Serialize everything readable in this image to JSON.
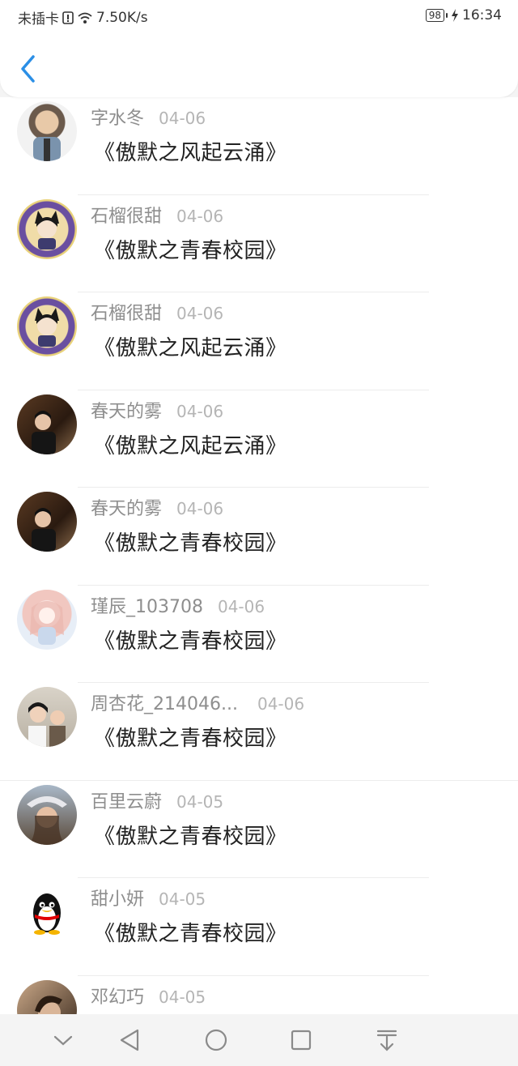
{
  "status_bar": {
    "carrier": "未插卡",
    "speed": "7.50K/s",
    "battery": "98",
    "time": "16:34"
  },
  "messages": [
    {
      "name": "字水冬",
      "date": "04-06",
      "title": "《傲默之风起云涌》",
      "avatar": "avatar-cartoon-boy-jacket"
    },
    {
      "name": "石榴很甜",
      "date": "04-06",
      "title": "《傲默之青春校园》",
      "avatar": "avatar-anime-catboy"
    },
    {
      "name": "石榴很甜",
      "date": "04-06",
      "title": "《傲默之风起云涌》",
      "avatar": "avatar-anime-catboy"
    },
    {
      "name": "春天的雾",
      "date": "04-06",
      "title": "《傲默之风起云涌》",
      "avatar": "avatar-photo-man"
    },
    {
      "name": "春天的雾",
      "date": "04-06",
      "title": "《傲默之青春校园》",
      "avatar": "avatar-photo-man"
    },
    {
      "name": "瑾辰_103708",
      "date": "04-06",
      "title": "《傲默之青春校园》",
      "avatar": "avatar-anime-girl"
    },
    {
      "name": "周杏花_214046...",
      "date": "04-06",
      "title": "《傲默之青春校园》",
      "avatar": "avatar-photo-mother-child"
    },
    {
      "name": "百里云蔚",
      "date": "04-05",
      "title": "《傲默之青春校园》",
      "avatar": "avatar-photo-woman-cap"
    },
    {
      "name": "甜小妍",
      "date": "04-05",
      "title": "《傲默之青春校园》",
      "avatar": "avatar-penguin"
    },
    {
      "name": "邓幻巧",
      "date": "04-05",
      "title": "",
      "avatar": "avatar-photo-woman"
    }
  ],
  "nav_icons": [
    "chevron-down-icon",
    "back-triangle-icon",
    "home-circle-icon",
    "recent-square-icon",
    "pull-down-icon"
  ],
  "colors": {
    "accent": "#2b8fe6",
    "text": "#222222",
    "muted": "#8e8e8e"
  }
}
